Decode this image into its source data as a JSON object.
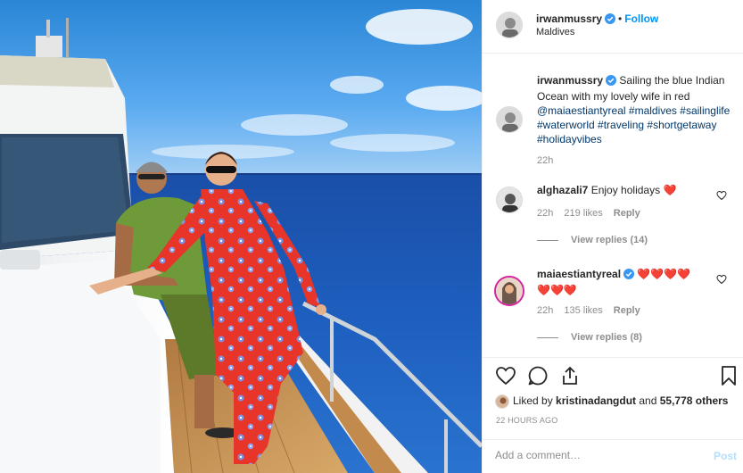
{
  "post": {
    "username": "irwanmussry",
    "follow_label": "Follow",
    "dot": "•",
    "location": "Maldives"
  },
  "caption": {
    "username": "irwanmussry",
    "text_1": "Sailing the blue Indian Ocean with my lovely wife in red ",
    "mention": "@maiaestiantyreal",
    "tags": "#maldives #sailinglife #waterworld #traveling #shortgetaway #holidayvibes",
    "time": "22h"
  },
  "comments": [
    {
      "username": "alghazali7",
      "text": "Enjoy holidays",
      "emoji": "❤️",
      "time": "22h",
      "likes": "219 likes",
      "reply": "Reply",
      "view_replies": "View replies (14)"
    },
    {
      "username": "maiaestiantyreal",
      "text": "",
      "emoji": "❤️❤️❤️❤️",
      "emoji2": "❤️❤️❤️",
      "time": "22h",
      "likes": "135 likes",
      "reply": "Reply",
      "view_replies": "View replies (8)"
    }
  ],
  "likes": {
    "prefix": "Liked by ",
    "user": "kristinadangdut",
    "middle": " and ",
    "count": "55,778 others"
  },
  "timestamp": "22 HOURS AGO",
  "add_comment": {
    "placeholder": "Add a comment…",
    "post_label": "Post"
  },
  "icons": {
    "verified": "verified-badge-icon",
    "like": "heart-icon",
    "comment": "comment-icon",
    "share": "share-icon",
    "save": "bookmark-icon"
  },
  "colors": {
    "accent": "#0095f6",
    "verified": "#3897f0",
    "heart_emoji": "#e0102e",
    "muted": "#8e8e8e"
  }
}
